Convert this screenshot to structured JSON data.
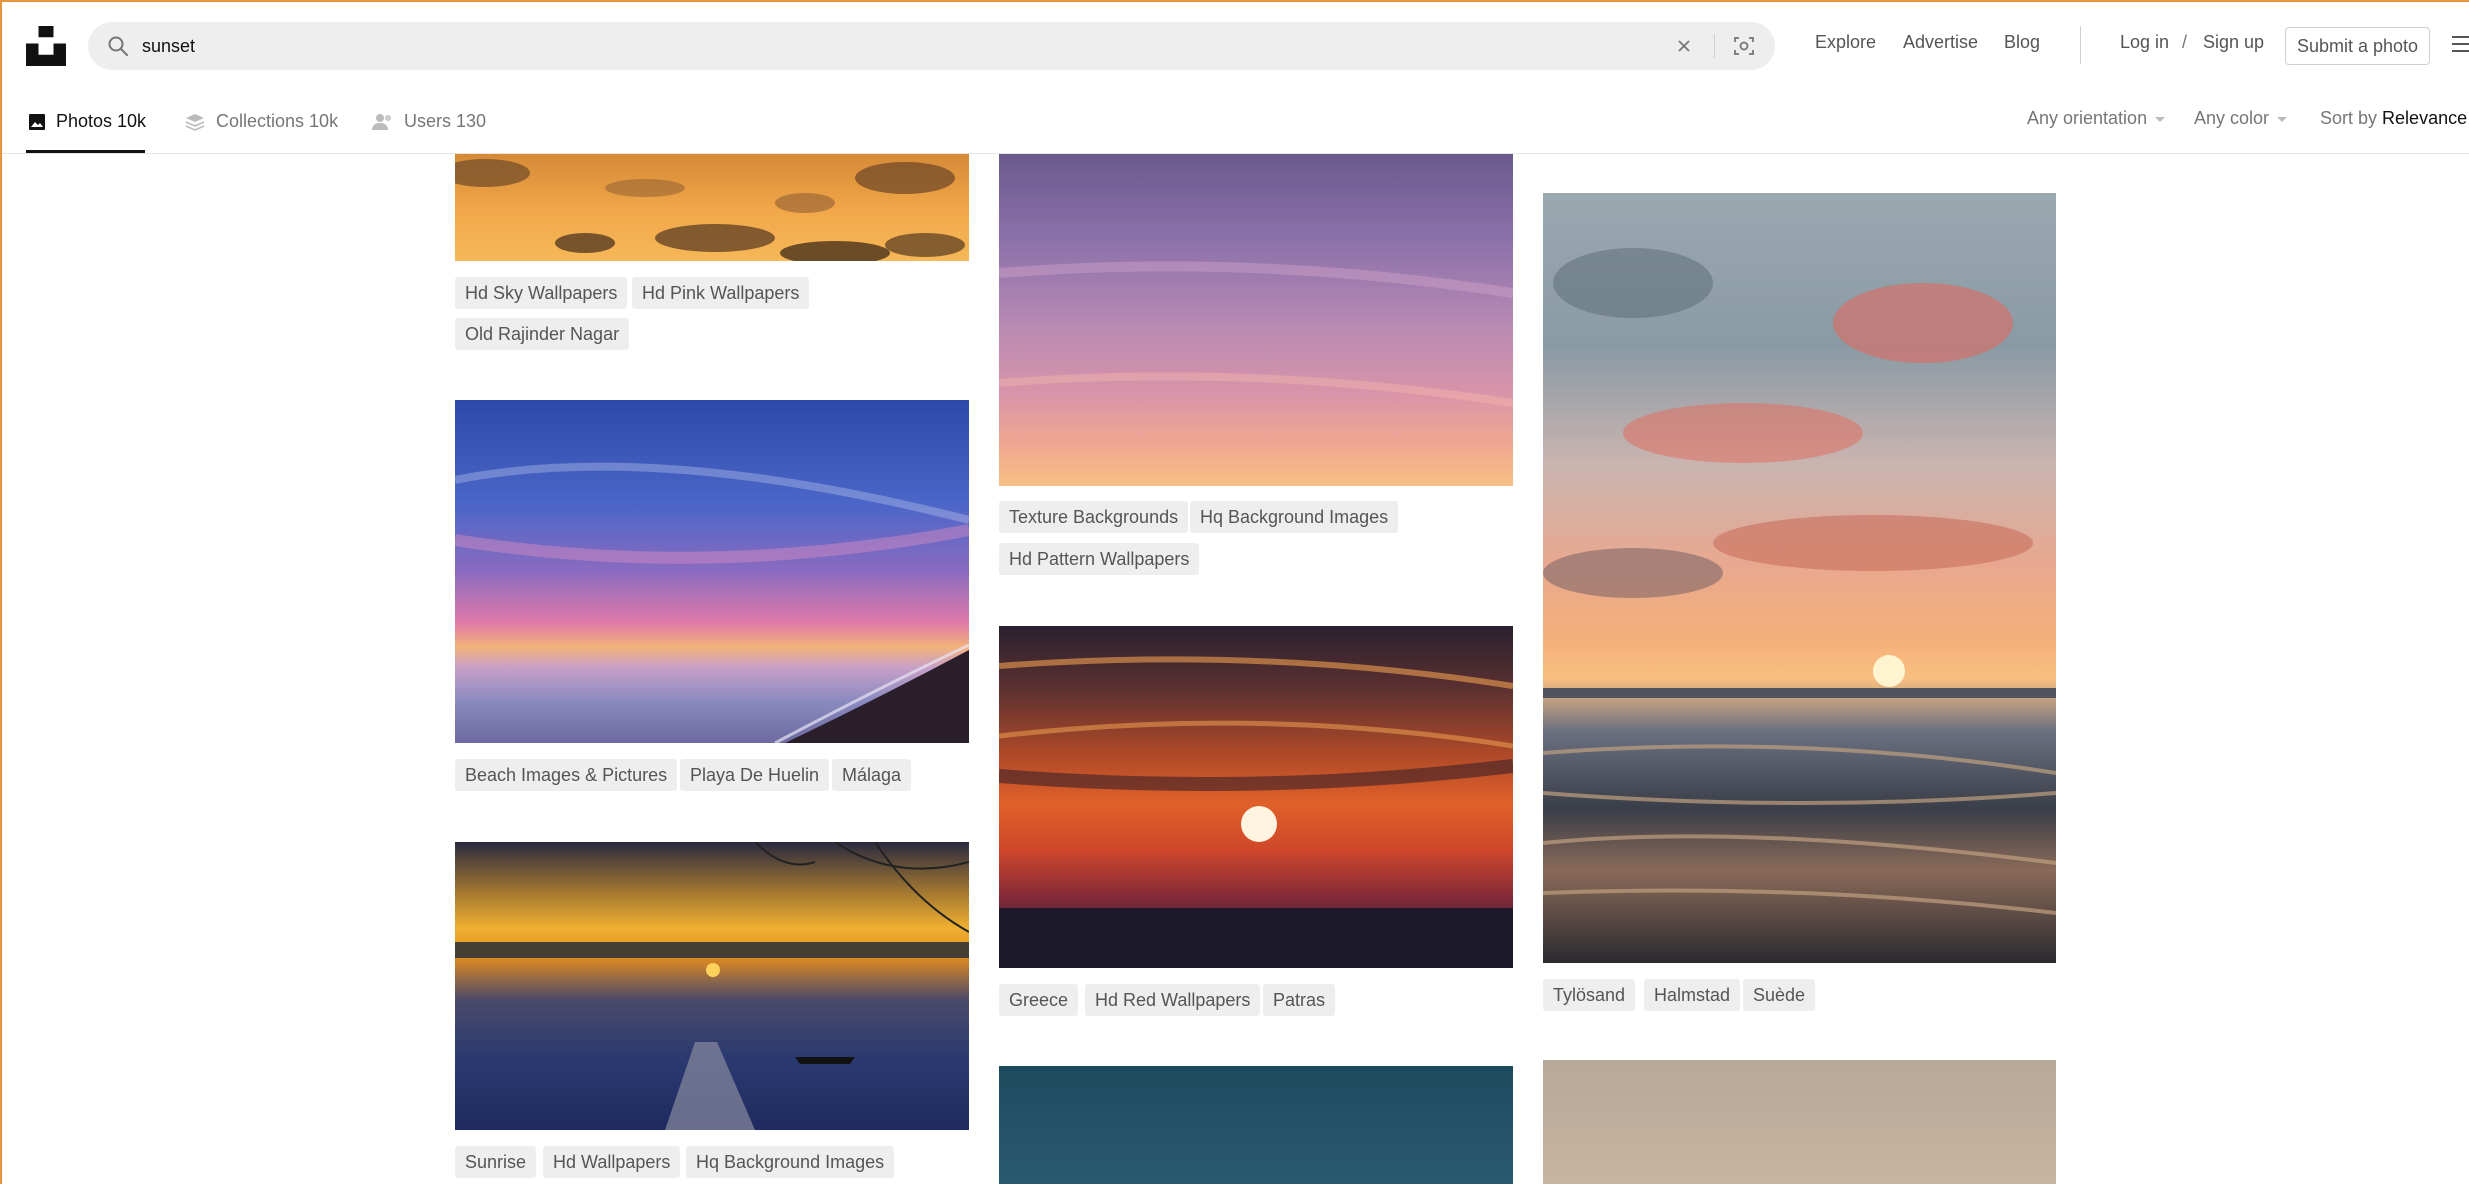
{
  "search": {
    "query": "sunset"
  },
  "nav": {
    "explore": "Explore",
    "advertise": "Advertise",
    "blog": "Blog",
    "login": "Log in",
    "separator": "/",
    "signup": "Sign up",
    "submit": "Submit a photo"
  },
  "tabs": {
    "photos": "Photos 10k",
    "collections": "Collections 10k",
    "users": "Users 130"
  },
  "filters": {
    "orientation": "Any orientation",
    "color": "Any color",
    "sort_prefix": "Sort by",
    "sort_value": "Relevance"
  },
  "photos": [
    {
      "tags": [
        "Hd Sky Wallpapers",
        "Hd Pink Wallpapers",
        "Old Rajinder Nagar"
      ]
    },
    {
      "tags": [
        "Beach Images & Pictures",
        "Playa De Huelin",
        "Málaga"
      ]
    },
    {
      "tags": [
        "Sunrise",
        "Hd Wallpapers",
        "Hq Background Images"
      ]
    },
    {
      "tags": [
        "Texture Backgrounds",
        "Hq Background Images",
        "Hd Pattern Wallpapers"
      ]
    },
    {
      "tags": [
        "Greece",
        "Hd Red Wallpapers",
        "Patras"
      ]
    },
    {
      "tags": []
    },
    {
      "tags": [
        "Tylösand",
        "Halmstad",
        "Suède"
      ]
    },
    {
      "tags": []
    }
  ],
  "colors": {
    "accent_frame": "#e8943a",
    "tag_bg": "#eeeeee",
    "search_bg": "#eeeeee"
  }
}
